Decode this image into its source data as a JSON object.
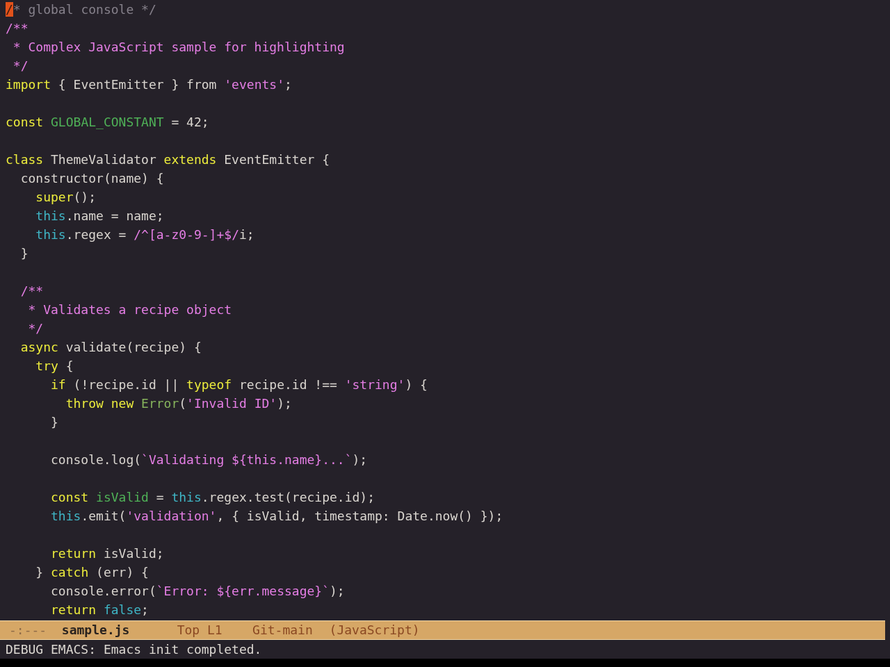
{
  "buffer": {
    "lines": [
      {
        "kind": "code",
        "tokens": [
          {
            "text": "/",
            "kind": "cursor"
          },
          {
            "text": "* global console */",
            "kind": "comment"
          }
        ]
      },
      {
        "kind": "code",
        "tokens": [
          {
            "text": "/**",
            "kind": "doc"
          }
        ]
      },
      {
        "kind": "code",
        "tokens": [
          {
            "text": " * Complex JavaScript sample for highlighting",
            "kind": "doc"
          }
        ]
      },
      {
        "kind": "code",
        "tokens": [
          {
            "text": " */",
            "kind": "doc"
          }
        ]
      },
      {
        "kind": "code",
        "tokens": [
          {
            "text": "import",
            "kind": "keyword"
          },
          {
            "text": " { EventEmitter } from ",
            "kind": "plain"
          },
          {
            "text": "'events'",
            "kind": "string"
          },
          {
            "text": ";",
            "kind": "plain"
          }
        ]
      },
      {
        "kind": "blank"
      },
      {
        "kind": "code",
        "tokens": [
          {
            "text": "const ",
            "kind": "keyword"
          },
          {
            "text": "GLOBAL_CONSTANT",
            "kind": "variable"
          },
          {
            "text": " = 42;",
            "kind": "plain"
          }
        ]
      },
      {
        "kind": "blank"
      },
      {
        "kind": "code",
        "tokens": [
          {
            "text": "class",
            "kind": "keyword"
          },
          {
            "text": " ThemeValidator ",
            "kind": "plain"
          },
          {
            "text": "extends",
            "kind": "keyword"
          },
          {
            "text": " EventEmitter {",
            "kind": "plain"
          }
        ]
      },
      {
        "kind": "code",
        "tokens": [
          {
            "text": "  constructor(name) {",
            "kind": "plain"
          }
        ]
      },
      {
        "kind": "code",
        "tokens": [
          {
            "text": "    super",
            "kind": "keyword"
          },
          {
            "text": "();",
            "kind": "plain"
          }
        ]
      },
      {
        "kind": "code",
        "tokens": [
          {
            "text": "    this",
            "kind": "builtin"
          },
          {
            "text": ".name = name;",
            "kind": "plain"
          }
        ]
      },
      {
        "kind": "code",
        "tokens": [
          {
            "text": "    this",
            "kind": "builtin"
          },
          {
            "text": ".regex = ",
            "kind": "plain"
          },
          {
            "text": "/^[a-z0-9-]+$/",
            "kind": "string"
          },
          {
            "text": "i;",
            "kind": "plain"
          }
        ]
      },
      {
        "kind": "code",
        "tokens": [
          {
            "text": "  }",
            "kind": "plain"
          }
        ]
      },
      {
        "kind": "blank"
      },
      {
        "kind": "code",
        "tokens": [
          {
            "text": "  /**",
            "kind": "doc"
          }
        ]
      },
      {
        "kind": "code",
        "tokens": [
          {
            "text": "   * Validates a recipe object",
            "kind": "doc"
          }
        ]
      },
      {
        "kind": "code",
        "tokens": [
          {
            "text": "   */",
            "kind": "doc"
          }
        ]
      },
      {
        "kind": "code",
        "tokens": [
          {
            "text": "  async",
            "kind": "keyword"
          },
          {
            "text": " validate(recipe) {",
            "kind": "plain"
          }
        ]
      },
      {
        "kind": "code",
        "tokens": [
          {
            "text": "    try",
            "kind": "keyword"
          },
          {
            "text": " {",
            "kind": "plain"
          }
        ]
      },
      {
        "kind": "code",
        "tokens": [
          {
            "text": "      if",
            "kind": "keyword"
          },
          {
            "text": " (!recipe.id || ",
            "kind": "plain"
          },
          {
            "text": "typeof",
            "kind": "keyword"
          },
          {
            "text": " recipe.id !== ",
            "kind": "plain"
          },
          {
            "text": "'string'",
            "kind": "string"
          },
          {
            "text": ") {",
            "kind": "plain"
          }
        ]
      },
      {
        "kind": "code",
        "tokens": [
          {
            "text": "        throw new ",
            "kind": "keyword"
          },
          {
            "text": "Error",
            "kind": "type"
          },
          {
            "text": "(",
            "kind": "plain"
          },
          {
            "text": "'Invalid ID'",
            "kind": "string"
          },
          {
            "text": ");",
            "kind": "plain"
          }
        ]
      },
      {
        "kind": "code",
        "tokens": [
          {
            "text": "      }",
            "kind": "plain"
          }
        ]
      },
      {
        "kind": "blank"
      },
      {
        "kind": "code",
        "tokens": [
          {
            "text": "      console.log(",
            "kind": "plain"
          },
          {
            "text": "`Validating ${this.name}...`",
            "kind": "string"
          },
          {
            "text": ");",
            "kind": "plain"
          }
        ]
      },
      {
        "kind": "blank"
      },
      {
        "kind": "code",
        "tokens": [
          {
            "text": "      const ",
            "kind": "keyword"
          },
          {
            "text": "isValid",
            "kind": "variable"
          },
          {
            "text": " = ",
            "kind": "plain"
          },
          {
            "text": "this",
            "kind": "builtin"
          },
          {
            "text": ".regex.test(recipe.id);",
            "kind": "plain"
          }
        ]
      },
      {
        "kind": "code",
        "tokens": [
          {
            "text": "      this",
            "kind": "builtin"
          },
          {
            "text": ".emit(",
            "kind": "plain"
          },
          {
            "text": "'validation'",
            "kind": "string"
          },
          {
            "text": ", { isValid, timestamp: Date.now() });",
            "kind": "plain"
          }
        ]
      },
      {
        "kind": "blank"
      },
      {
        "kind": "code",
        "tokens": [
          {
            "text": "      return",
            "kind": "keyword"
          },
          {
            "text": " isValid;",
            "kind": "plain"
          }
        ]
      },
      {
        "kind": "code",
        "tokens": [
          {
            "text": "    } ",
            "kind": "plain"
          },
          {
            "text": "catch",
            "kind": "keyword"
          },
          {
            "text": " (err) {",
            "kind": "plain"
          }
        ]
      },
      {
        "kind": "code",
        "tokens": [
          {
            "text": "      console.error(",
            "kind": "plain"
          },
          {
            "text": "`Error: ${err.message}`",
            "kind": "string"
          },
          {
            "text": ");",
            "kind": "plain"
          }
        ]
      },
      {
        "kind": "code",
        "tokens": [
          {
            "text": "      return ",
            "kind": "keyword"
          },
          {
            "text": "false",
            "kind": "builtin"
          },
          {
            "text": ";",
            "kind": "plain"
          }
        ]
      }
    ]
  },
  "mode_line": {
    "status": "-:---",
    "buffer_name": "sample.js",
    "position": "Top L1",
    "vc_branch": "Git-main",
    "major_mode": "(JavaScript)"
  },
  "echo_area": {
    "message": "DEBUG EMACS: Emacs init completed."
  }
}
